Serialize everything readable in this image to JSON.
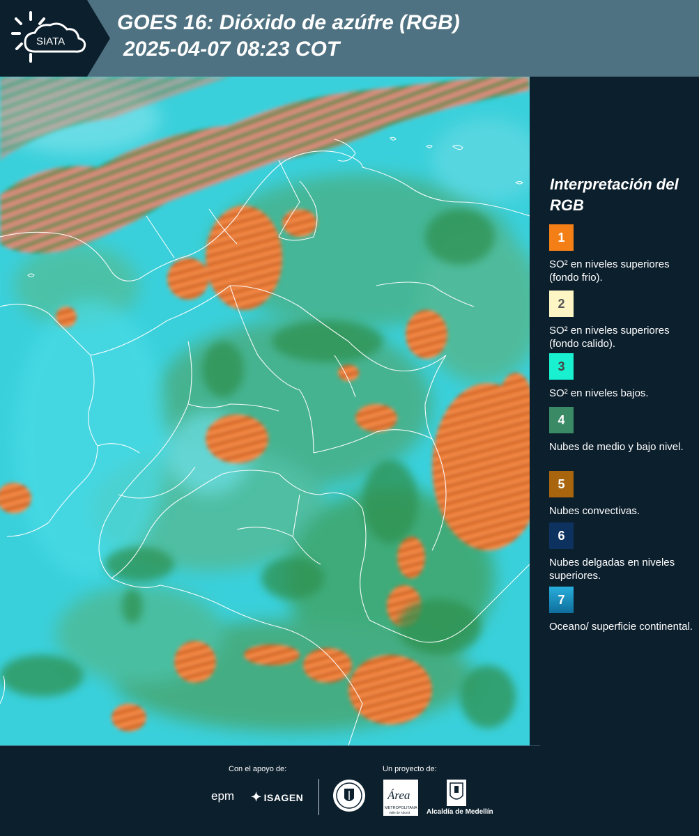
{
  "header": {
    "logo_text": "SIATA",
    "title_line1": "GOES 16: Dióxido de azúfre (RGB)",
    "title_line2": "2025-04-07 08:23 COT"
  },
  "legend": {
    "title": "Interpretación del RGB",
    "items": [
      {
        "number": "1",
        "color": "#f57f17",
        "text": "SO² en niveles superiores (fondo frio)."
      },
      {
        "number": "2",
        "color": "#fdf6c4",
        "text": "SO² en niveles superiores (fondo calido)."
      },
      {
        "number": "3",
        "color": "#18f0cf",
        "text": "SO² en niveles bajos."
      },
      {
        "number": "4",
        "color": "#3a8a65",
        "text": "Nubes de medio y bajo nivel."
      },
      {
        "number": "5",
        "color": "#a9650d",
        "text": "Nubes convectivas."
      },
      {
        "number": "6",
        "color": "#0d3260",
        "text": "Nubes delgadas en niveles superiores."
      },
      {
        "number": "7",
        "color": "#1d8fc0",
        "text": "Oceano/ superficie continental."
      }
    ]
  },
  "footer": {
    "support_label": "Con el apoyo de:",
    "project_label": "Un proyecto de:",
    "epm_logo": "epm",
    "isagen_logo": "ISAGEN",
    "area_logo_text": "Área",
    "area_logo_subtext": "METROPOLITANA",
    "area_logo_subtext2": "Valle de Aburrá",
    "alcaldia_label": "Alcaldía de Medellín"
  },
  "colors": {
    "header_bg": "#4e7281",
    "panel_bg": "#0c1f2d",
    "map_background": "#3ad0db",
    "cloud_green": "#3d9a58",
    "cloud_orange": "#f07a2c",
    "cloud_pink": "#ec7a86"
  }
}
